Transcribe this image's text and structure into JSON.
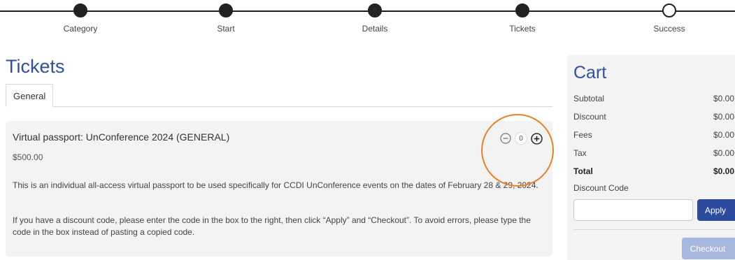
{
  "stepper": {
    "steps": [
      {
        "label": "Category",
        "state": "done"
      },
      {
        "label": "Start",
        "state": "done"
      },
      {
        "label": "Details",
        "state": "done"
      },
      {
        "label": "Tickets",
        "state": "done"
      },
      {
        "label": "Success",
        "state": "pending"
      }
    ]
  },
  "tickets": {
    "title": "Tickets",
    "tabs": [
      {
        "label": "General"
      }
    ],
    "item": {
      "name": "Virtual passport: UnConference 2024 (GENERAL)",
      "price": "$500.00",
      "quantity": "0",
      "description": "This is an individual all-access virtual passport to be used specifically for CCDI UnConference events on the dates of February 28 & 29, 2024.",
      "note": "If you have a discount code, please enter the code in the box to the right, then click “Apply” and “Checkout”. To avoid errors, please type the code in the box instead of pasting a copied code."
    }
  },
  "cart": {
    "title": "Cart",
    "rows": [
      {
        "label": "Subtotal",
        "value": "$0.00"
      },
      {
        "label": "Discount",
        "value": "$0.00"
      },
      {
        "label": "Fees",
        "value": "$0.00"
      },
      {
        "label": "Tax",
        "value": "$0.00"
      },
      {
        "label": "Total",
        "value": "$0.00"
      }
    ],
    "discount_label": "Discount Code",
    "discount_value": "",
    "apply_label": "Apply",
    "checkout_label": "Checkout"
  },
  "colors": {
    "accent": "#2f4fa3",
    "button": "#2c4a9e",
    "button_disabled": "#a8b7de",
    "highlight": "#e8822a"
  },
  "icons": {
    "decrement": "minus-circle-icon",
    "increment": "plus-circle-icon"
  }
}
